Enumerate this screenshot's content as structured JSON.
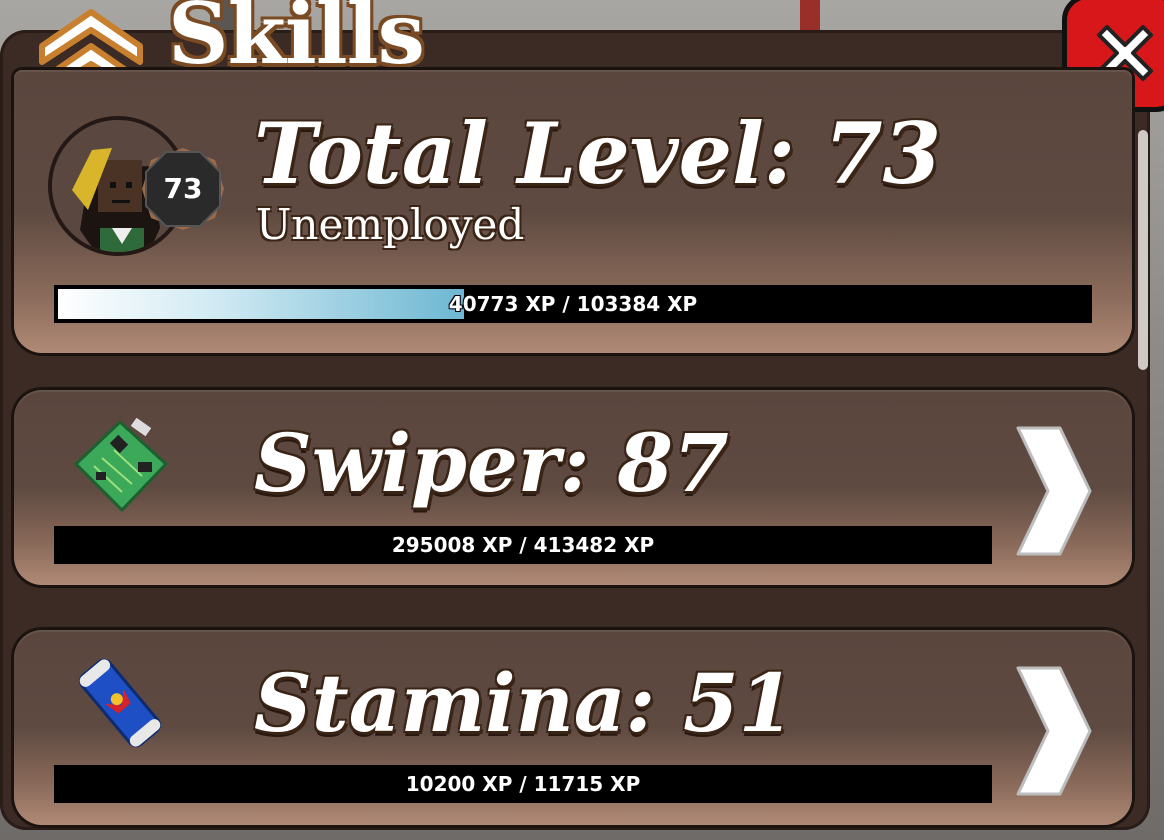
{
  "header": {
    "title": "Skills"
  },
  "total": {
    "title": "Total Level: 73",
    "badge": "73",
    "job": "Unemployed",
    "xp_text": "40773 XP / 103384 XP",
    "xp_progress": 0.394
  },
  "skills": [
    {
      "title": "Swiper: 87",
      "xp_text": "295008 XP / 413482 XP",
      "icon": "circuit-board-icon"
    },
    {
      "title": "Stamina: 51",
      "xp_text": "10200 XP / 11715 XP",
      "icon": "energy-drink-icon"
    }
  ],
  "colors": {
    "close": "#d8171b",
    "panel": "#3b2b24",
    "bar_fill": "#6db7d2"
  }
}
